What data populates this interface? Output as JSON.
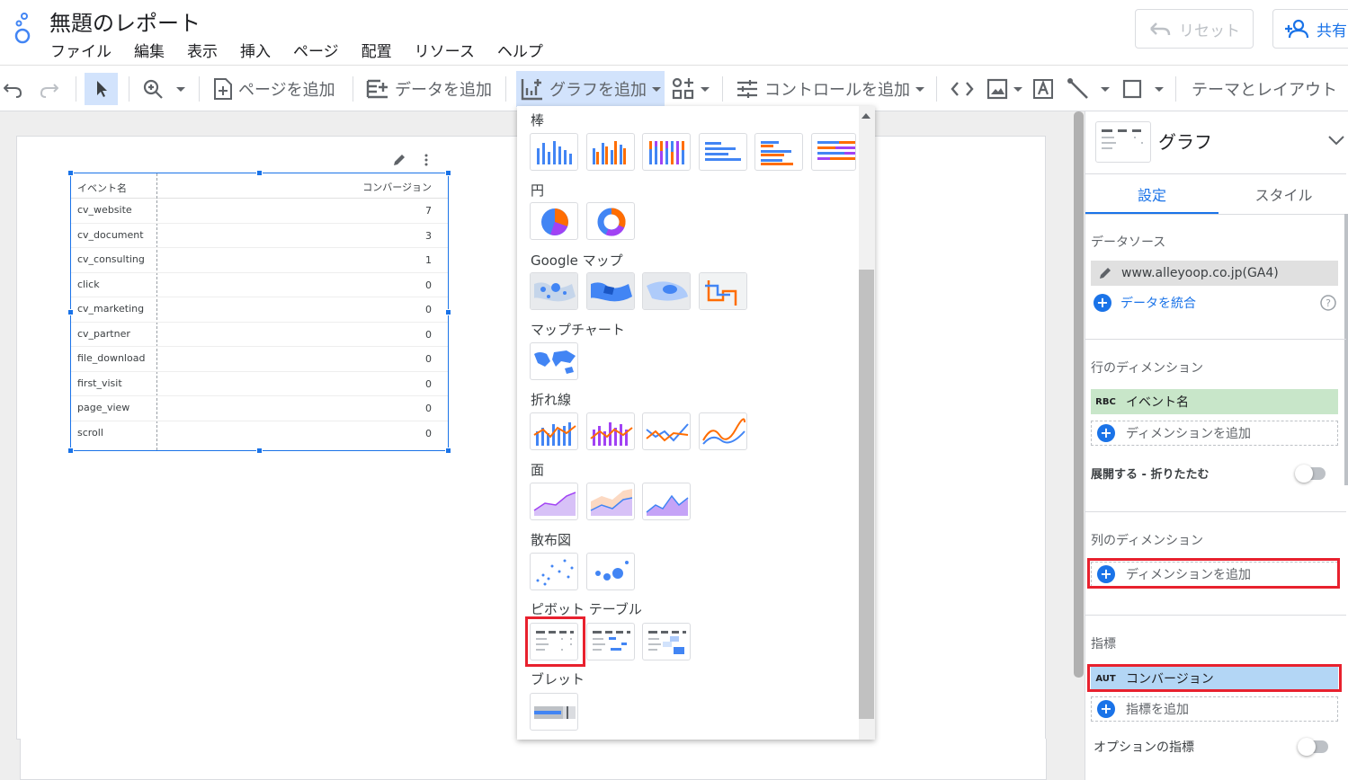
{
  "app": {
    "title": "無題のレポート",
    "menu": [
      "ファイル",
      "編集",
      "表示",
      "挿入",
      "ページ",
      "配置",
      "リソース",
      "ヘルプ"
    ],
    "reset_label": "リセット",
    "share_label": "共有"
  },
  "toolbar": {
    "add_page": "ページを追加",
    "add_data": "データを追加",
    "add_chart": "グラフを追加",
    "add_control": "コントロールを追加",
    "theme_layout": "テーマとレイアウト"
  },
  "table": {
    "headers": [
      "イベント名",
      "コンバージョン"
    ],
    "rows": [
      [
        "cv_website",
        "7"
      ],
      [
        "cv_document",
        "3"
      ],
      [
        "cv_consulting",
        "1"
      ],
      [
        "click",
        "0"
      ],
      [
        "cv_marketing",
        "0"
      ],
      [
        "cv_partner",
        "0"
      ],
      [
        "file_download",
        "0"
      ],
      [
        "first_visit",
        "0"
      ],
      [
        "page_view",
        "0"
      ],
      [
        "scroll",
        "0"
      ]
    ]
  },
  "chart_menu": {
    "sections": [
      "棒",
      "円",
      "Google マップ",
      "マップチャート",
      "折れ線",
      "面",
      "散布図",
      "ピボット テーブル",
      "ブレット"
    ]
  },
  "panel": {
    "chart_type": "グラフ",
    "tabs": [
      "設定",
      "スタイル"
    ],
    "datasource_label": "データソース",
    "datasource": "www.alleyoop.co.jp(GA4)",
    "blend_data": "データを統合",
    "row_dimension_label": "行のディメンション",
    "row_dimension_badge": "RBC",
    "row_dimension": "イベント名",
    "add_dimension": "ディメンションを追加",
    "expand_collapse": "展開する - 折りたたむ",
    "column_dimension_label": "列のディメンション",
    "metric_label": "指標",
    "metric_badge": "AUT",
    "metric": "コンバージョン",
    "add_metric": "指標を追加",
    "optional_metrics": "オプションの指標"
  },
  "colors": {
    "accent": "#1a73e8",
    "highlight_red": "#e8212e",
    "dimension_chip": "#c8e6c9",
    "metric_chip": "#b3d6f5"
  }
}
